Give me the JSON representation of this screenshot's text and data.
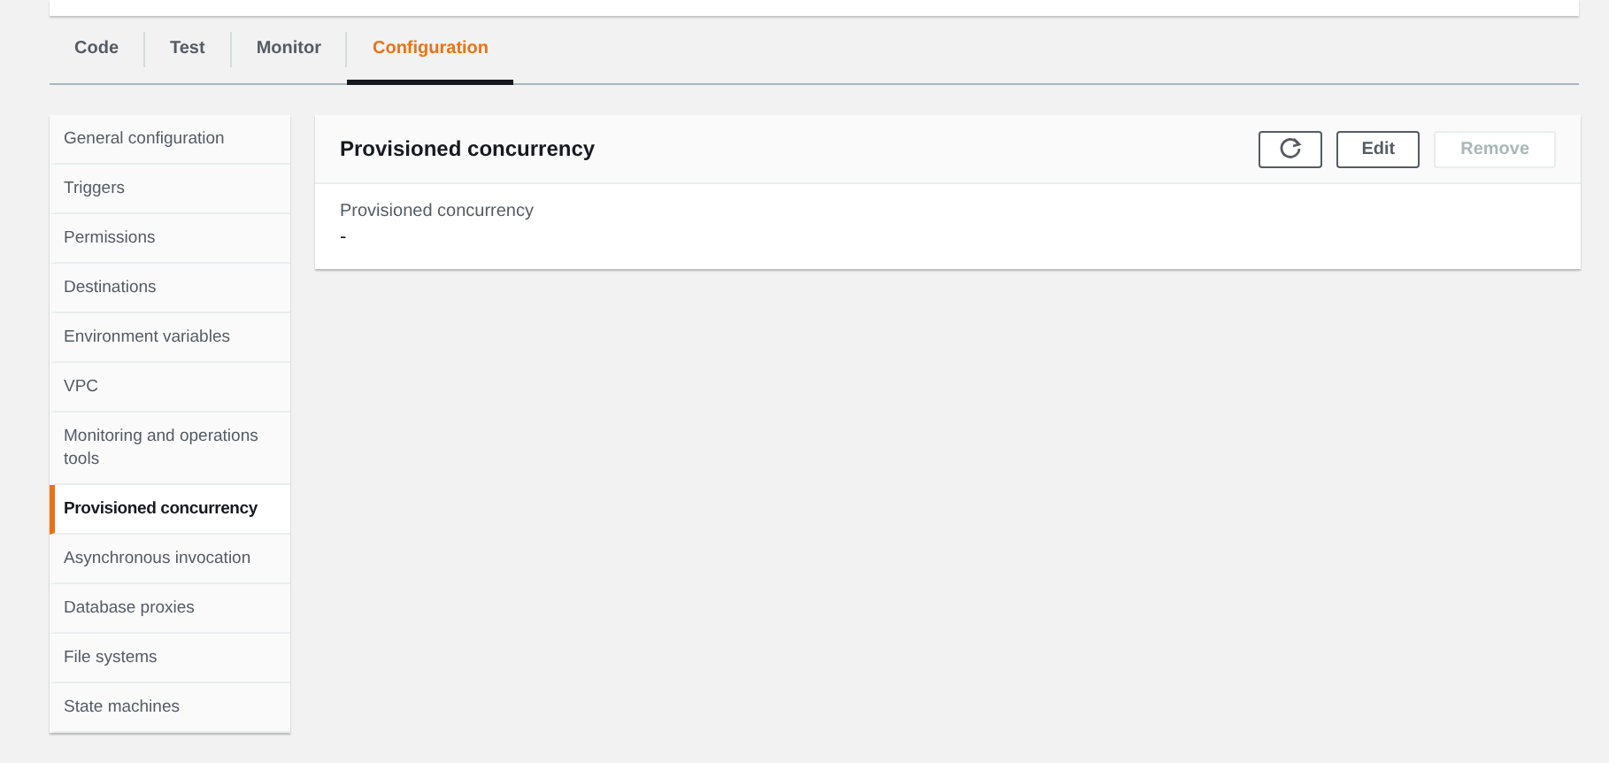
{
  "tabs": [
    {
      "label": "Code",
      "selected": false
    },
    {
      "label": "Test",
      "selected": false
    },
    {
      "label": "Monitor",
      "selected": false
    },
    {
      "label": "Configuration",
      "selected": true
    }
  ],
  "sidebar": {
    "items": [
      {
        "label": "General configuration",
        "selected": false
      },
      {
        "label": "Triggers",
        "selected": false
      },
      {
        "label": "Permissions",
        "selected": false
      },
      {
        "label": "Destinations",
        "selected": false
      },
      {
        "label": "Environment variables",
        "selected": false
      },
      {
        "label": "VPC",
        "selected": false
      },
      {
        "label": "Monitoring and operations tools",
        "selected": false
      },
      {
        "label": "Provisioned concurrency",
        "selected": true
      },
      {
        "label": "Asynchronous invocation",
        "selected": false
      },
      {
        "label": "Database proxies",
        "selected": false
      },
      {
        "label": "File systems",
        "selected": false
      },
      {
        "label": "State machines",
        "selected": false
      }
    ]
  },
  "panel": {
    "title": "Provisioned concurrency",
    "buttons": [
      {
        "kind": "refresh",
        "disabled": false
      },
      {
        "kind": "text",
        "label": "Edit",
        "disabled": false
      },
      {
        "kind": "text",
        "label": "Remove",
        "disabled": true
      }
    ],
    "field": {
      "label": "Provisioned concurrency",
      "value": "-"
    }
  }
}
